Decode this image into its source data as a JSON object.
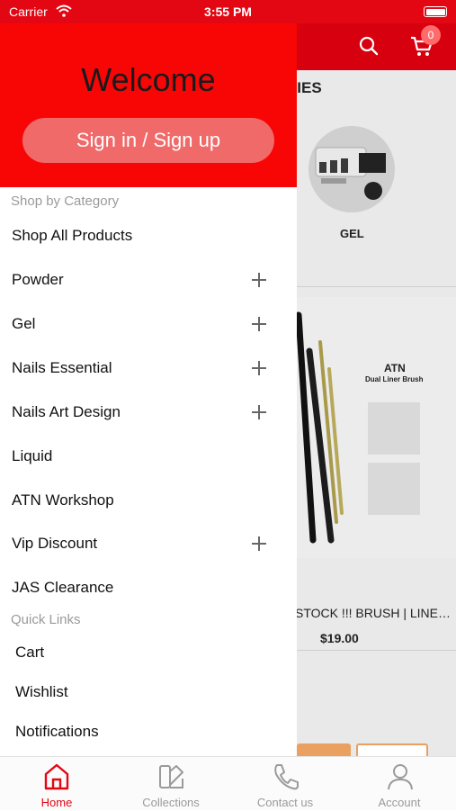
{
  "status_bar": {
    "carrier": "Carrier",
    "time": "3:55 PM"
  },
  "background": {
    "cart_count": "0",
    "section_title_partial": "RIES",
    "category_label": "GEL",
    "product_brand": "ATN",
    "product_brand_sub": "Dual Liner Brush",
    "product_name": "STOCK !!! BRUSH | LINE…",
    "product_price": "$19.00"
  },
  "drawer": {
    "welcome": "Welcome",
    "sign_button": "Sign in / Sign up",
    "shop_by_category_label": "Shop by Category",
    "categories": [
      {
        "label": "Shop All Products",
        "expandable": false
      },
      {
        "label": "Powder",
        "expandable": true
      },
      {
        "label": "Gel",
        "expandable": true
      },
      {
        "label": "Nails Essential",
        "expandable": true
      },
      {
        "label": "Nails Art Design",
        "expandable": true
      },
      {
        "label": "Liquid",
        "expandable": false
      },
      {
        "label": "ATN Workshop",
        "expandable": false
      },
      {
        "label": "Vip Discount",
        "expandable": true
      },
      {
        "label": "JAS Clearance",
        "expandable": false
      }
    ],
    "quick_links_label": "Quick Links",
    "quick_links": [
      {
        "label": "Cart"
      },
      {
        "label": "Wishlist"
      },
      {
        "label": "Notifications"
      }
    ]
  },
  "tabs": [
    {
      "label": "Home",
      "icon": "home-icon",
      "active": true
    },
    {
      "label": "Collections",
      "icon": "collections-icon",
      "active": false
    },
    {
      "label": "Contact us",
      "icon": "phone-icon",
      "active": false
    },
    {
      "label": "Account",
      "icon": "account-icon",
      "active": false
    }
  ],
  "colors": {
    "brand_red": "#e30613",
    "drawer_header_red": "#f80606",
    "sign_button": "#f06a6a",
    "muted_text": "#9a9a9a"
  }
}
